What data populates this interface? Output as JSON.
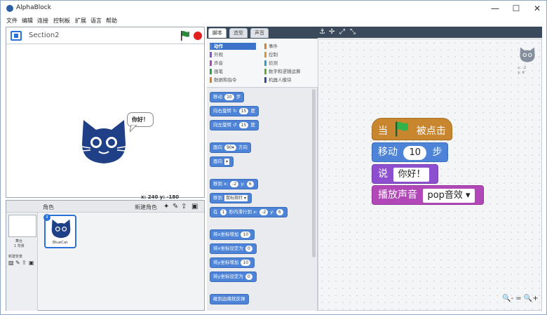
{
  "window": {
    "title": "AlphaBlock",
    "controls": [
      "—",
      "☐",
      "✕"
    ]
  },
  "menu": [
    "文件",
    "编辑",
    "连接",
    "控制板",
    "扩展",
    "语言",
    "帮助"
  ],
  "stage": {
    "name": "Section2",
    "speech": "你好！",
    "coords": "x: 240  y: -180"
  },
  "sprites": {
    "header_label": "角色",
    "new_sprite_label": "新建角色",
    "stage_label": "舞台",
    "stage_sub": "1 背景",
    "new_backdrop_label": "新建背景",
    "items": [
      {
        "name": "BlueCat"
      }
    ]
  },
  "tabs": [
    "脚本",
    "造型",
    "声音"
  ],
  "categories": {
    "left": [
      {
        "label": "动作",
        "color": "#4d84d8",
        "active": true
      },
      {
        "label": "外观",
        "color": "#8d4fd0"
      },
      {
        "label": "声音",
        "color": "#b248b8"
      },
      {
        "label": "画笔",
        "color": "#2aa04a"
      },
      {
        "label": "数据和指令",
        "color": "#e07a1f"
      }
    ],
    "right": [
      {
        "label": "事件",
        "color": "#c8862e"
      },
      {
        "label": "控制",
        "color": "#d69a2a"
      },
      {
        "label": "侦测",
        "color": "#2ea0c8"
      },
      {
        "label": "数字和逻辑运算",
        "color": "#5cb030"
      },
      {
        "label": "机器人模块",
        "color": "#3a4a8c"
      }
    ]
  },
  "palette_blocks": {
    "b1": {
      "pre": "移动",
      "v": "10",
      "post": "步"
    },
    "b2": {
      "pre": "向右旋转 ↻",
      "v": "15",
      "post": "度"
    },
    "b3": {
      "pre": "向左旋转 ↺",
      "v": "15",
      "post": "度"
    },
    "b4": {
      "pre": "面向",
      "v": "90▾",
      "post": "方向"
    },
    "b5": {
      "pre": "面向",
      "v": "▾"
    },
    "b6": {
      "pre": "移到 x:",
      "v": "-2",
      "mid": "y:",
      "v2": "6"
    },
    "b7": {
      "pre": "移到",
      "v": "鼠标指针 ▾"
    },
    "b8": {
      "pre": "在",
      "v": "1",
      "mid": "秒内滑行到 x:",
      "v2": "-2",
      "mid2": "y:",
      "v3": "6"
    },
    "b9": {
      "pre": "将x坐标增加",
      "v": "10"
    },
    "b10": {
      "pre": "将x坐标设定为",
      "v": "0"
    },
    "b11": {
      "pre": "将y坐标增加",
      "v": "10"
    },
    "b12": {
      "pre": "将y坐标设定为",
      "v": "0"
    },
    "b13": {
      "pre": "碰到边缘就反弹"
    }
  },
  "script": {
    "hat_pre": "当",
    "hat_post": "被点击",
    "move_pre": "移动",
    "move_val": "10",
    "move_post": "步",
    "say_pre": "说",
    "say_val": "你好！",
    "sound_pre": "播放声音",
    "sound_val": "pop音效 ▾"
  },
  "sprite_corner": {
    "x": "x: -2",
    "y": "y: 6"
  },
  "zoom": [
    "🔍-",
    "=",
    "🔍+"
  ],
  "colors": {
    "accent": "#2a72d8",
    "cat": "#1f3f86",
    "stop": "#e0201c",
    "flag": "#2a8a3a"
  }
}
